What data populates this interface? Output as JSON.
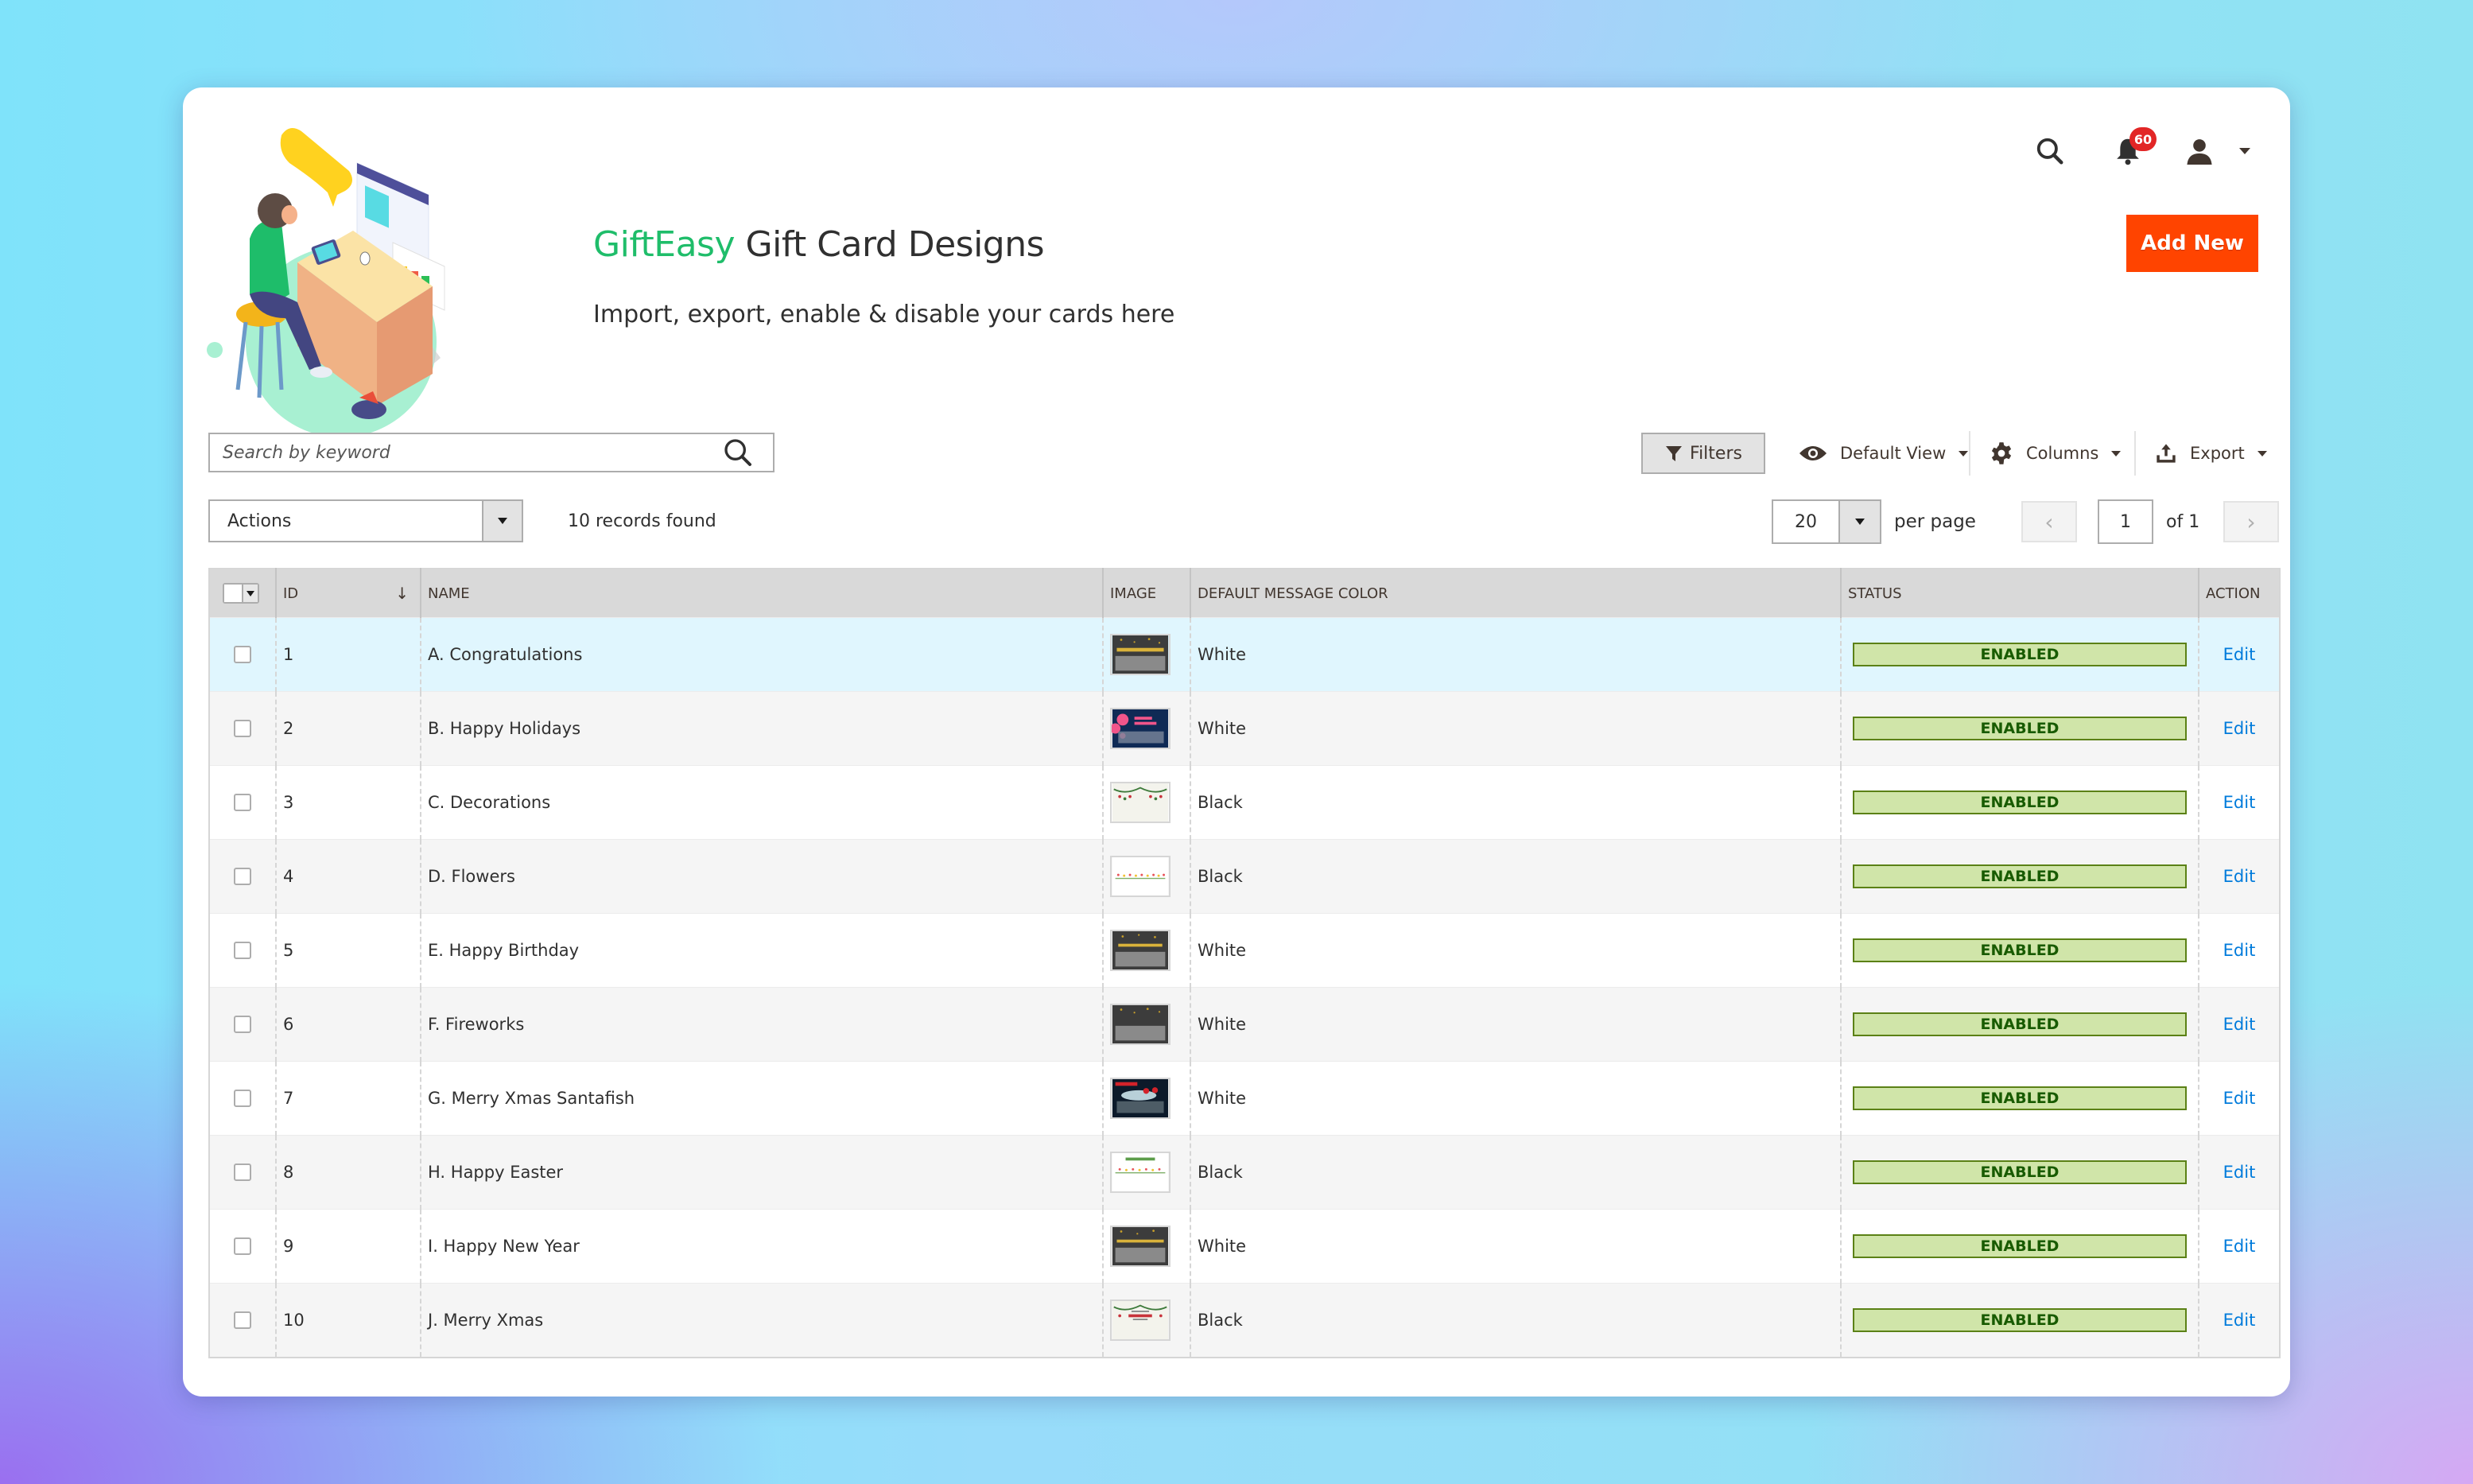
{
  "header": {
    "brand": "GiftEasy",
    "title_rest": " Gift Card Designs",
    "subtitle": "Import, export, enable & disable your cards here",
    "notifications_count": "60",
    "add_new_label": "Add New"
  },
  "colors": {
    "brand_green": "#1fbd6a",
    "add_new_bg": "#ff4400",
    "status_bg": "#d0e5a9",
    "status_text": "#185b00",
    "link_blue": "#007bdb",
    "badge_red": "#e22626"
  },
  "toolbar": {
    "search_placeholder": "Search by keyword",
    "filters_label": "Filters",
    "view_label": "Default View",
    "columns_label": "Columns",
    "export_label": "Export",
    "actions_label": "Actions",
    "records_found": "10 records found",
    "per_page_value": "20",
    "per_page_label": "per page",
    "page_current": "1",
    "page_of": "of 1",
    "prev_label": "‹",
    "next_label": "›"
  },
  "grid": {
    "columns": [
      "",
      "ID",
      "Name",
      "Image",
      "Default Message Color",
      "Status",
      "Action"
    ],
    "sort_indicator": "↓",
    "rows": [
      {
        "id": "1",
        "name": "A. Congratulations",
        "thumb": "congratulations",
        "color": "White",
        "status": "ENABLED",
        "action": "Edit"
      },
      {
        "id": "2",
        "name": "B. Happy Holidays",
        "thumb": "happy-holidays",
        "color": "White",
        "status": "ENABLED",
        "action": "Edit"
      },
      {
        "id": "3",
        "name": "C. Decorations",
        "thumb": "decorations",
        "color": "Black",
        "status": "ENABLED",
        "action": "Edit"
      },
      {
        "id": "4",
        "name": "D. Flowers",
        "thumb": "flowers",
        "color": "Black",
        "status": "ENABLED",
        "action": "Edit"
      },
      {
        "id": "5",
        "name": "E. Happy Birthday",
        "thumb": "happy-birthday",
        "color": "White",
        "status": "ENABLED",
        "action": "Edit"
      },
      {
        "id": "6",
        "name": "F. Fireworks",
        "thumb": "fireworks",
        "color": "White",
        "status": "ENABLED",
        "action": "Edit"
      },
      {
        "id": "7",
        "name": "G. Merry Xmas Santafish",
        "thumb": "santafish",
        "color": "White",
        "status": "ENABLED",
        "action": "Edit"
      },
      {
        "id": "8",
        "name": "H. Happy Easter",
        "thumb": "happy-easter",
        "color": "Black",
        "status": "ENABLED",
        "action": "Edit"
      },
      {
        "id": "9",
        "name": "I. Happy New Year",
        "thumb": "happy-new-year",
        "color": "White",
        "status": "ENABLED",
        "action": "Edit"
      },
      {
        "id": "10",
        "name": "J. Merry Xmas",
        "thumb": "merry-xmas",
        "color": "Black",
        "status": "ENABLED",
        "action": "Edit"
      }
    ]
  }
}
